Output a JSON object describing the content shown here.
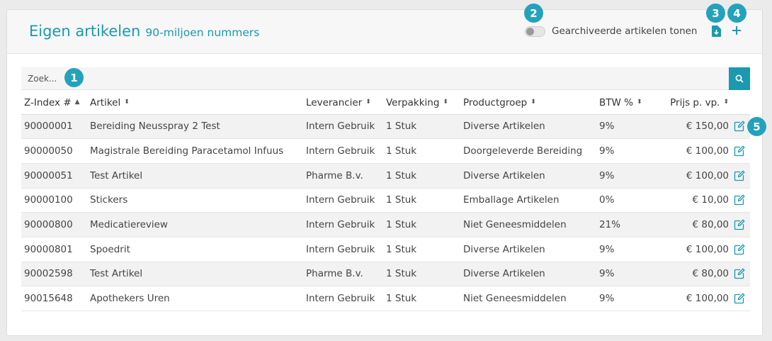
{
  "header": {
    "title": "Eigen artikelen",
    "subtitle": "90-miljoen nummers",
    "archived_toggle_label": "Gearchiveerde artikelen tonen"
  },
  "search": {
    "placeholder": "Zoek..."
  },
  "markers": {
    "m1": "1",
    "m2": "2",
    "m3": "3",
    "m4": "4",
    "m5": "5"
  },
  "table": {
    "columns": [
      "Z-Index #",
      "Artikel",
      "Leverancier",
      "Verpakking",
      "Productgroep",
      "BTW %",
      "Prijs p. vp."
    ],
    "rows": [
      {
        "zindex": "90000001",
        "artikel": "Bereiding Neusspray 2 Test",
        "leverancier": "Intern Gebruik",
        "verpakking": "1 Stuk",
        "productgroep": "Diverse Artikelen",
        "btw": "9%",
        "prijs": "€ 150,00"
      },
      {
        "zindex": "90000050",
        "artikel": "Magistrale Bereiding Paracetamol Infuus",
        "leverancier": "Intern Gebruik",
        "verpakking": "1 Stuk",
        "productgroep": "Doorgeleverde Bereiding",
        "btw": "9%",
        "prijs": "€ 100,00"
      },
      {
        "zindex": "90000051",
        "artikel": "Test Artikel",
        "leverancier": "Pharme B.v.",
        "verpakking": "1 Stuk",
        "productgroep": "Diverse Artikelen",
        "btw": "9%",
        "prijs": "€ 100,00"
      },
      {
        "zindex": "90000100",
        "artikel": "Stickers",
        "leverancier": "Intern Gebruik",
        "verpakking": "1 Stuk",
        "productgroep": "Emballage Artikelen",
        "btw": "0%",
        "prijs": "€ 10,00"
      },
      {
        "zindex": "90000800",
        "artikel": "Medicatiereview",
        "leverancier": "Intern Gebruik",
        "verpakking": "1 Stuk",
        "productgroep": "Niet Geneesmiddelen",
        "btw": "21%",
        "prijs": "€ 80,00"
      },
      {
        "zindex": "90000801",
        "artikel": "Spoedrit",
        "leverancier": "Intern Gebruik",
        "verpakking": "1 Stuk",
        "productgroep": "Diverse Artikelen",
        "btw": "9%",
        "prijs": "€ 100,00"
      },
      {
        "zindex": "90002598",
        "artikel": "Test Artikel",
        "leverancier": "Pharme B.v.",
        "verpakking": "1 Stuk",
        "productgroep": "Diverse Artikelen",
        "btw": "9%",
        "prijs": "€ 80,00"
      },
      {
        "zindex": "90015648",
        "artikel": "Apothekers Uren",
        "leverancier": "Intern Gebruik",
        "verpakking": "1 Stuk",
        "productgroep": "Niet Geneesmiddelen",
        "btw": "9%",
        "prijs": "€ 100,00"
      }
    ]
  },
  "icons": {
    "download": "download-file-icon",
    "add": "plus-icon",
    "search": "search-icon",
    "edit": "edit-icon",
    "sort": "sort-icon"
  },
  "colors": {
    "accent": "#1a99b0",
    "marker": "#25a2bb"
  }
}
